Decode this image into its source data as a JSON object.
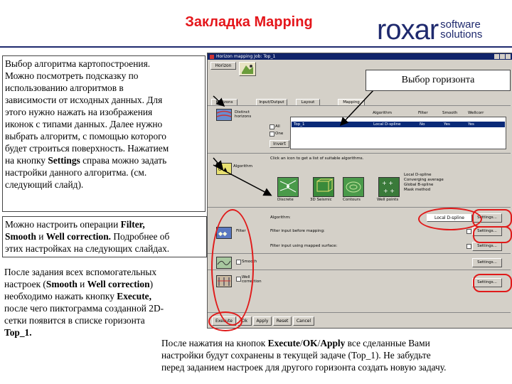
{
  "header": {
    "title": "Закладка Mapping",
    "logo_main": "roxar",
    "logo_sub_1": "software",
    "logo_sub_2": "solutions"
  },
  "app": {
    "window_title": "Horizon mapping  Job: Top_1",
    "horizon_button": "Horizon",
    "tabs": [
      "Horizons",
      "Input/Output",
      "Layout",
      "Mapping"
    ],
    "data_types": {
      "label_distinct": "Distinct\nhorizons",
      "label_algorithm": "Algorithm"
    },
    "horizon_checks": [
      "All",
      "One"
    ],
    "invert_button": "Invert",
    "grid_headers": [
      "Algorithm",
      "Filter",
      "Smooth",
      "Wellcorr"
    ],
    "selected_row": {
      "horizon": "Top_1",
      "algorithm": "Local D-spline",
      "filter": "No",
      "smooth": "Yes",
      "wellcorr": "Yes"
    },
    "hint_text": "Click an icon to get a list of suitable algorithms.",
    "algorithm_icons": [
      "Discrete",
      "3D Seismic",
      "Contours",
      "Well points"
    ],
    "algorithm_list": [
      "Local D-spline",
      "Converging average",
      "Global B-spline",
      "Mask method"
    ],
    "algorithm_label": "Algorithm:",
    "algorithm_value": "Local D-spline",
    "settings_label": "Settings...",
    "filter_label": "Filter",
    "filter_before": "Filter input before mapping:",
    "filter_using": "Filter input using mapped surface:",
    "smooth_label": "Smooth",
    "well_label": "Well\ncorrection",
    "bottom_buttons": [
      "Execute",
      "Ok",
      "Apply",
      "Reset",
      "Cancel"
    ]
  },
  "callouts": {
    "intro_1": "Выбор алгоритма картопостроения.",
    "intro_2": "Можно посмотреть подсказку по",
    "intro_3": "использованию алгоритмов в",
    "intro_4": "зависимости от исходных данных. Для",
    "intro_5": "этого нужно нажать на изображения",
    "intro_6": "иконок с типами данных. Далее нужно",
    "intro_7": "выбрать алгоритм, с помощью которого",
    "intro_8": "будет строиться поверхность. Нажатием",
    "intro_9a": "на кнопку ",
    "intro_9b": "Settings",
    "intro_9c": " справа можно задать",
    "intro_10": "настройки данного алгоритма. (см.",
    "intro_11": "следующий слайд).",
    "ops_1a": "Можно настроить операции ",
    "ops_1b": "Filter,",
    "ops_2a": "Smooth",
    "ops_2b": " и ",
    "ops_2c": "Well correction.",
    "ops_2d": " Подробнее об",
    "ops_3": "этих настройках на следующих слайдах.",
    "exec_1": "После задания всех вспомогательных",
    "exec_2a": "настроек (",
    "exec_2b": "Smooth",
    "exec_2c": " и ",
    "exec_2d": "Well correction",
    "exec_2e": ")",
    "exec_3a": "необходимо нажать кнопку ",
    "exec_3b": "Execute,",
    "exec_4": "после чего пиктограмма созданной 2D-",
    "exec_5": "сетки появится в списке горизонта",
    "exec_6": "Top_1.",
    "apply_1a": "После нажатия на кнопок ",
    "apply_1b": "Execute",
    "apply_1c": "/",
    "apply_1d": "OK",
    "apply_1e": "/",
    "apply_1f": "Apply",
    "apply_1g": " все сделанные Вами",
    "apply_2": "настройки будут сохранены в текущей задаче (Top_1). Не забудьте",
    "apply_3": "перед заданием настроек для другого горизонта создать новую задачу.",
    "horizon_pick": "Выбор горизонта"
  },
  "colors": {
    "title_red": "#e4161b",
    "logo_navy": "#1f2a6e",
    "highlight_red": "#e01a1a",
    "selection_blue": "#0a2a78"
  }
}
